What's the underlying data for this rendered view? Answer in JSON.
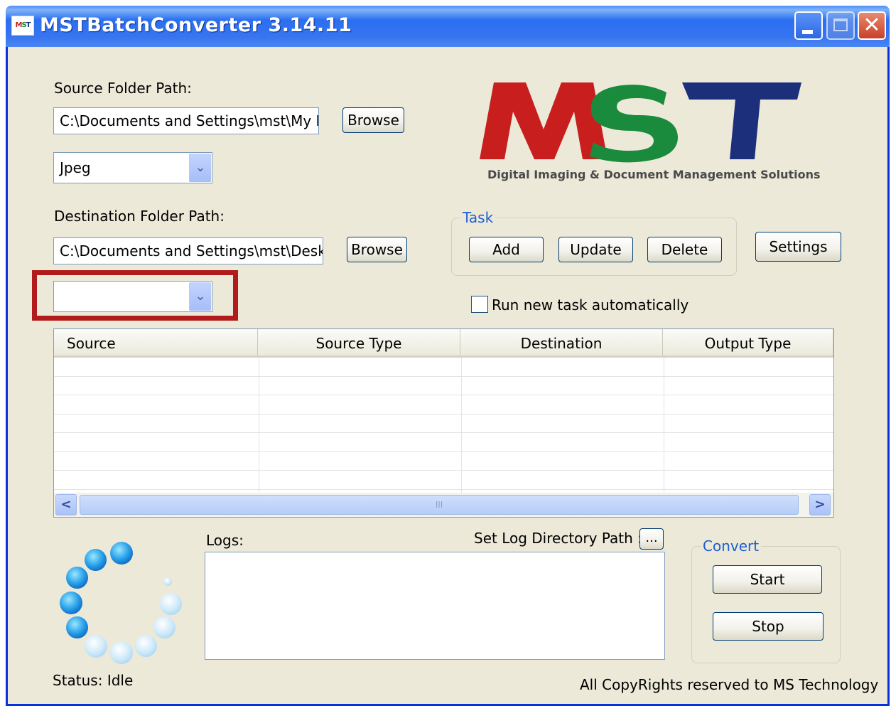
{
  "window": {
    "title": "MSTBatchConverter 3.14.11",
    "icon_text": [
      "M",
      "S",
      "T"
    ]
  },
  "source": {
    "label": "Source Folder Path:",
    "path": "C:\\Documents and Settings\\mst\\My Do",
    "browse": "Browse",
    "type_value": "Jpeg"
  },
  "destination": {
    "label": "Destination Folder Path:",
    "path": "C:\\Documents and Settings\\mst\\Deskto",
    "browse": "Browse",
    "type_value": ""
  },
  "logo": {
    "letters": [
      "M",
      "S",
      "T"
    ],
    "tagline": "Digital Imaging & Document Management Solutions",
    "colors": {
      "m": "#c81e1e",
      "s": "#1a8a3c",
      "t": "#1c2f7a"
    }
  },
  "task": {
    "label": "Task",
    "add": "Add",
    "update": "Update",
    "delete": "Delete"
  },
  "settings": "Settings",
  "auto_run": {
    "label": "Run new task automatically",
    "checked": false
  },
  "table": {
    "columns": [
      "Source",
      "Source Type",
      "Destination",
      "Output Type"
    ],
    "rows": []
  },
  "scrollbar": {
    "left": "<",
    "right": ">",
    "thumb": "III"
  },
  "logs": {
    "label": "Logs:",
    "set_dir_label": "Set Log Directory Path :",
    "set_dir_button": "..."
  },
  "convert": {
    "label": "Convert",
    "start": "Start",
    "stop": "Stop"
  },
  "status": "Status: Idle",
  "copyright": "All CopyRights reserved to MS Technology",
  "colors": {
    "titlebar": "#2a6ff0",
    "window_bg": "#ece9d8",
    "highlight": "#b11b1b",
    "group_label": "#1f5fd1"
  }
}
